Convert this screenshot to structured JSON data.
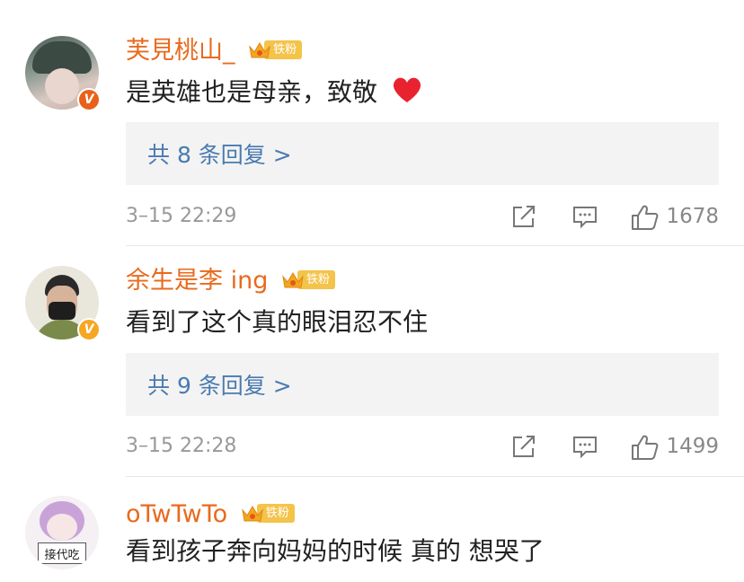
{
  "comments": [
    {
      "username": "芙見桃山_",
      "fan_badge": "铁粉",
      "text": "是英雄也是母亲，致敬",
      "emoji": "❤️",
      "replies": "共 8 条回复 >",
      "time": "3–15 22:29",
      "likes": "1678",
      "verified_color": "#e8611a"
    },
    {
      "username": "余生是李 ing",
      "fan_badge": "铁粉",
      "text": "看到了这个真的眼泪忍不住",
      "replies": "共 9 条回复 >",
      "time": "3–15 22:28",
      "likes": "1499",
      "verified_color": "#f5a623"
    },
    {
      "username": "oTwTwTo",
      "fan_badge": "铁粉",
      "text": "看到孩子奔向妈妈的时候 真的 想哭了",
      "avatar_sign": "接代吃"
    }
  ],
  "colors": {
    "username": "#e86a1e",
    "reply_link": "#4a7bb0",
    "fan_badge": "#f4c34a"
  }
}
